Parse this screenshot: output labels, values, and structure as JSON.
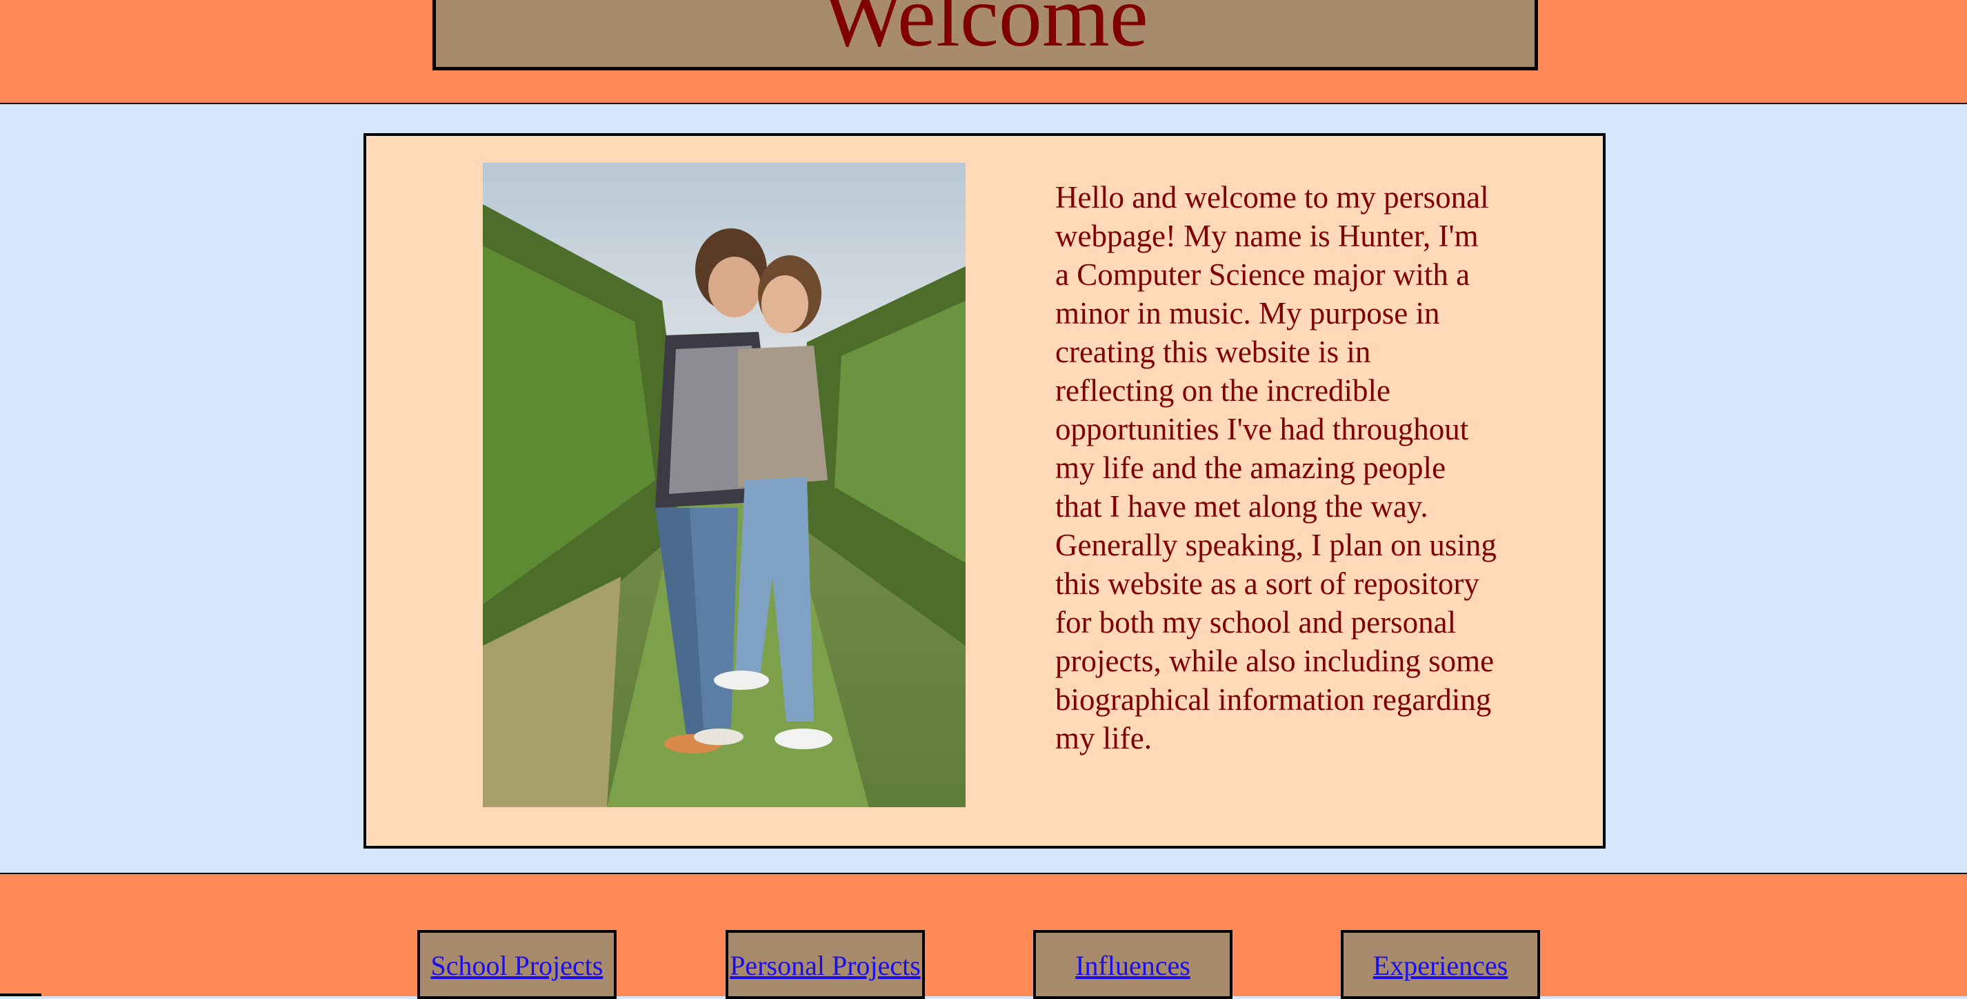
{
  "header": {
    "title": "Welcome"
  },
  "main": {
    "photo_alt": "",
    "intro": "Hello and welcome to my personal webpage! My name is Hunter, I'm a Computer Science major with a minor in music. My purpose in creating this website is in reflecting on the incredible opportunities I've had throughout my life and the amazing people that I have met along the way. Generally speaking, I plan on using this website as a sort of repository for both my school and personal projects, while also including some biographical information regarding my life."
  },
  "nav": {
    "items": [
      {
        "label": "School Projects"
      },
      {
        "label": "Personal Projects"
      },
      {
        "label": "Influences"
      },
      {
        "label": "Experiences"
      }
    ]
  },
  "colors": {
    "header_bg": "#ff8957",
    "page_bg": "#d6e8fd",
    "card_bg": "#ffd9b8",
    "button_bg": "#a78b6c",
    "text": "#800000",
    "link": "#1a0dee"
  }
}
